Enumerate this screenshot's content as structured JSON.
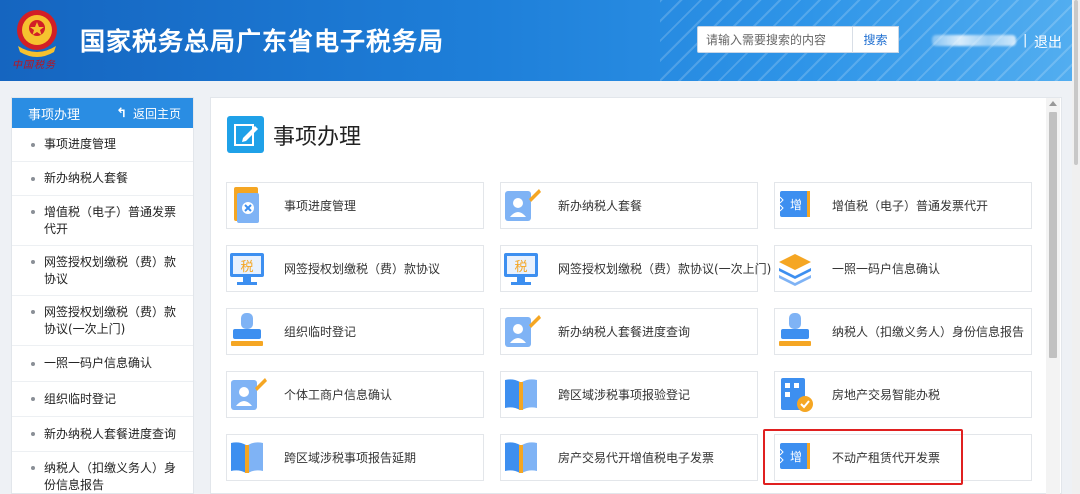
{
  "header": {
    "title": "国家税务总局广东省电子税务局",
    "emblem_caption": "中国税务",
    "search_placeholder": "请输入需要搜索的内容",
    "search_button": "搜索",
    "divider": "|",
    "logout": "退出"
  },
  "sidebar": {
    "title": "事项办理",
    "back_label": "返回主页",
    "back_icon": "back-arrow-icon",
    "items": [
      {
        "label": "事项进度管理"
      },
      {
        "label": "新办纳税人套餐"
      },
      {
        "label": "增值税（电子）普通发票代开"
      },
      {
        "label": "网签授权划缴税（费）款协议"
      },
      {
        "label": "网签授权划缴税（费）款协议(一次上门)"
      },
      {
        "label": "一照一码户信息确认"
      },
      {
        "label": "组织临时登记"
      },
      {
        "label": "新办纳税人套餐进度查询"
      },
      {
        "label": "纳税人（扣缴义务人）身份信息报告"
      }
    ]
  },
  "main": {
    "title": "事项办理",
    "title_icon": "edit-icon",
    "tiles": [
      {
        "label": "事项进度管理",
        "icon": "cancel-document-icon"
      },
      {
        "label": "新办纳税人套餐",
        "icon": "user-pen-icon"
      },
      {
        "label": "增值税（电子）普通发票代开",
        "icon": "invoice-ticket-icon"
      },
      {
        "label": "网签授权划缴税（费）款协议",
        "icon": "tax-monitor-icon"
      },
      {
        "label": "网签授权划缴税（费）款协议(一次上门)",
        "icon": "tax-monitor-icon"
      },
      {
        "label": "一照一码户信息确认",
        "icon": "layers-icon"
      },
      {
        "label": "组织临时登记",
        "icon": "stamp-icon"
      },
      {
        "label": "新办纳税人套餐进度查询",
        "icon": "user-pen-icon"
      },
      {
        "label": "纳税人（扣缴义务人）身份信息报告",
        "icon": "stamp-icon"
      },
      {
        "label": "个体工商户信息确认",
        "icon": "user-pen-icon"
      },
      {
        "label": "跨区域涉税事项报验登记",
        "icon": "book-icon"
      },
      {
        "label": "房地产交易智能办税",
        "icon": "building-check-icon"
      },
      {
        "label": "跨区域涉税事项报告延期",
        "icon": "book-icon"
      },
      {
        "label": "房产交易代开增值税电子发票",
        "icon": "book-icon"
      },
      {
        "label": "不动产租赁代开发票",
        "icon": "invoice-ticket-icon"
      }
    ]
  },
  "colors": {
    "header_blue": "#1e7fd9",
    "sidebar_head": "#2a8de3",
    "accent_orange": "#f5a623",
    "icon_blue": "#3d8ff0",
    "highlight_red": "#e02020"
  }
}
